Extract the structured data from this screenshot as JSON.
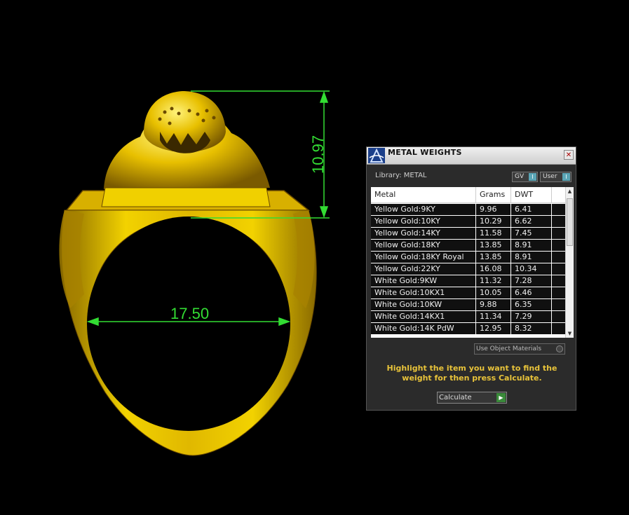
{
  "viewport": {
    "dim_height": "10.97",
    "dim_width": "17.50",
    "colors": {
      "dimension": "#33dd33",
      "gold": "#e8c000",
      "gold_dark": "#8a6a00",
      "background": "#000000"
    }
  },
  "panel": {
    "title": "METAL WEIGHTS",
    "close_glyph": "✕",
    "library_label": "Library: METAL",
    "toggle_gv": "GV",
    "toggle_user": "User",
    "toggle_knob": "I",
    "columns": {
      "metal": "Metal",
      "grams": "Grams",
      "dwt": "DWT"
    },
    "rows": [
      {
        "metal": "Yellow Gold:9KY",
        "grams": "9.96",
        "dwt": "6.41"
      },
      {
        "metal": "Yellow Gold:10KY",
        "grams": "10.29",
        "dwt": "6.62"
      },
      {
        "metal": "Yellow Gold:14KY",
        "grams": "11.58",
        "dwt": "7.45"
      },
      {
        "metal": "Yellow Gold:18KY",
        "grams": "13.85",
        "dwt": "8.91"
      },
      {
        "metal": "Yellow Gold:18KY Royal",
        "grams": "13.85",
        "dwt": "8.91"
      },
      {
        "metal": "Yellow Gold:22KY",
        "grams": "16.08",
        "dwt": "10.34"
      },
      {
        "metal": "White Gold:9KW",
        "grams": "11.32",
        "dwt": "7.28"
      },
      {
        "metal": "White Gold:10KX1",
        "grams": "10.05",
        "dwt": "6.46"
      },
      {
        "metal": "White Gold:10KW",
        "grams": "9.88",
        "dwt": "6.35"
      },
      {
        "metal": "White Gold:14KX1",
        "grams": "11.34",
        "dwt": "7.29"
      },
      {
        "metal": "White Gold:14K PdW",
        "grams": "12.95",
        "dwt": "8.32"
      }
    ],
    "use_object_materials": "Use Object Materials",
    "instruction": "Highlight the item you want to find the weight for then press Calculate.",
    "calculate": "Calculate",
    "scroll_up_glyph": "▲",
    "scroll_down_glyph": "▼",
    "calc_arrow_glyph": "▶",
    "colors": {
      "instruction": "#e8c33a",
      "row_bg": "#101010",
      "toggle_knob": "#5aa5b5",
      "calc_arrow": "#3a8a3a"
    }
  }
}
